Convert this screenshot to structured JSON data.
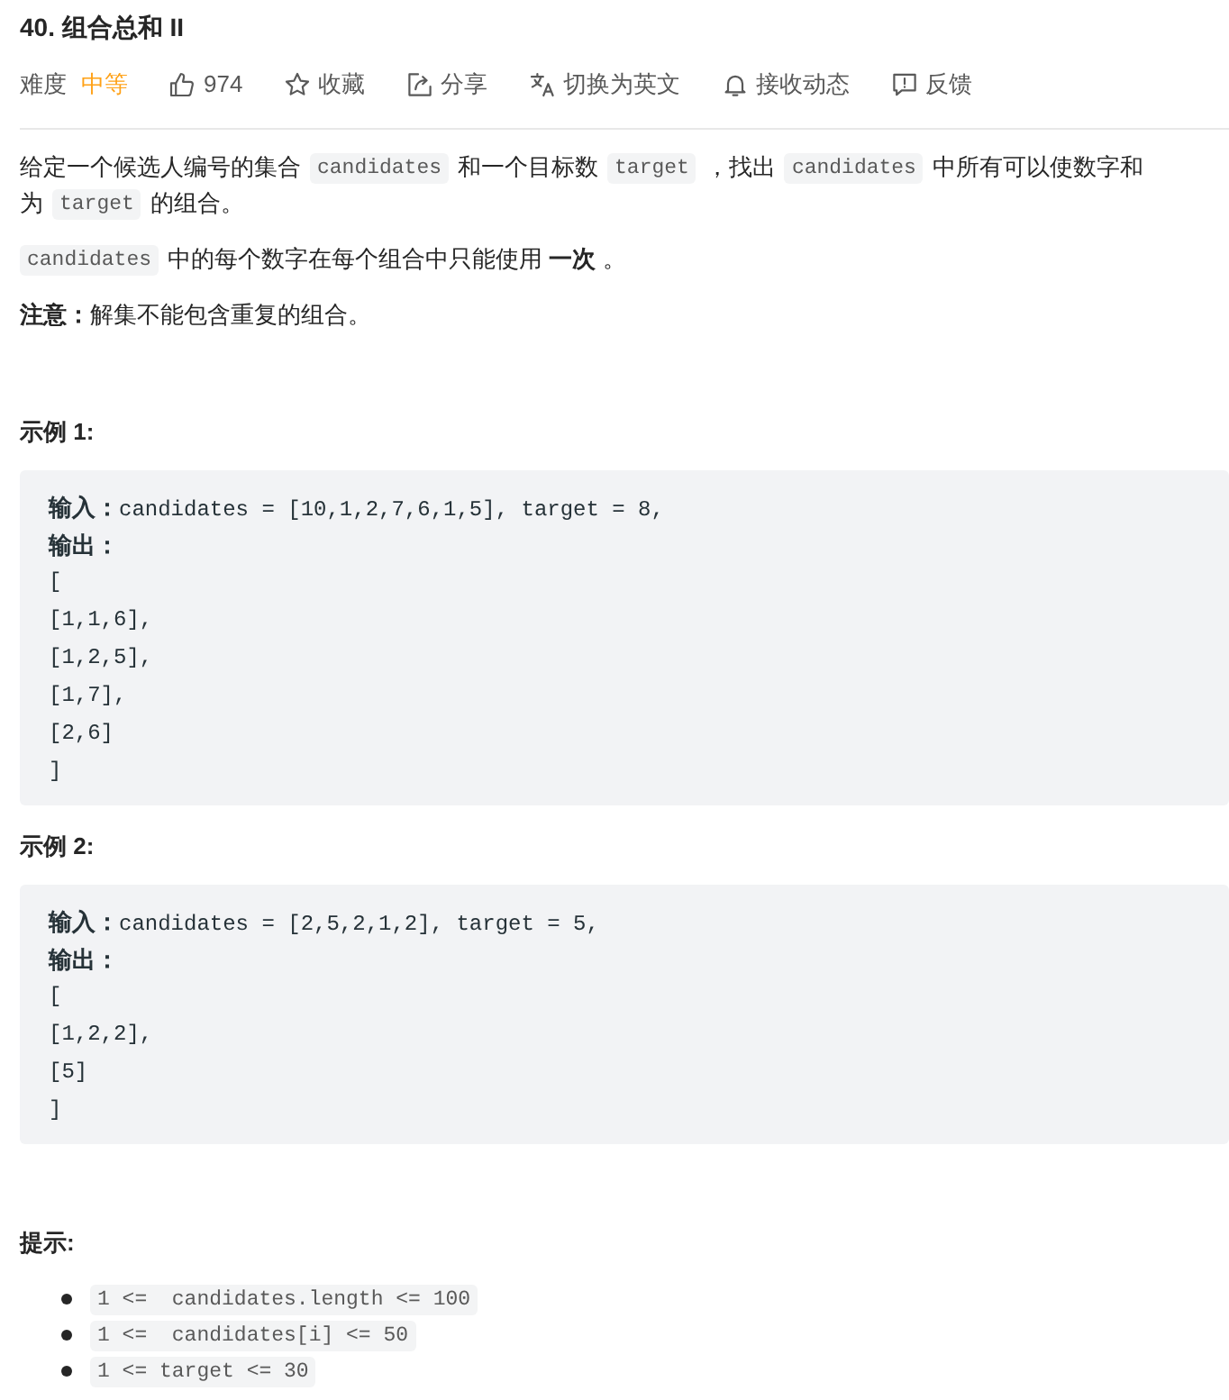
{
  "problem": {
    "title": "40. 组合总和 II"
  },
  "meta": {
    "difficulty": {
      "label": "难度",
      "value": "中等",
      "kind": "medium"
    },
    "actions": [
      {
        "kind": "like",
        "label": "974"
      },
      {
        "kind": "favorite",
        "label": "收藏"
      },
      {
        "kind": "share",
        "label": "分享"
      },
      {
        "kind": "translate",
        "label": "切换为英文"
      },
      {
        "kind": "subscribe",
        "label": "接收动态"
      },
      {
        "kind": "feedback",
        "label": "反馈"
      }
    ]
  },
  "description": [
    {
      "lines": [
        [
          {
            "kind": "text",
            "text": "给定一个候选人编号的集合"
          },
          {
            "kind": "code",
            "text": "candidates"
          },
          {
            "kind": "text",
            "text": "和一个目标数"
          },
          {
            "kind": "code",
            "text": "target"
          },
          {
            "kind": "text",
            "text": "，找出"
          },
          {
            "kind": "code",
            "text": "candidates"
          },
          {
            "kind": "text",
            "text": "中所有可以使数字和"
          }
        ],
        [
          {
            "kind": "text",
            "text": "为"
          },
          {
            "kind": "code",
            "text": "target"
          },
          {
            "kind": "text",
            "text": "的组合。"
          }
        ]
      ]
    },
    {
      "lines": [
        [
          {
            "kind": "code",
            "text": "candidates"
          },
          {
            "kind": "text",
            "text": "中的每个数字在每个组合中只能使用 **一次** 。"
          }
        ]
      ]
    },
    {
      "lines": [
        [
          {
            "kind": "text",
            "text": "**注意：**解集不能包含重复的组合。"
          }
        ]
      ]
    }
  ],
  "examples": [
    {
      "title": "示例 1:",
      "lines": [
        "**输入：**candidates = [10,1,2,7,6,1,5], target = 8,",
        "**输出：**",
        "[",
        "[1,1,6],",
        "[1,2,5],",
        "[1,7],",
        "[2,6]",
        "]"
      ]
    },
    {
      "title": "示例 2:",
      "lines": [
        "**输入：**candidates = [2,5,2,1,2], target = 5,",
        "**输出：**",
        "[",
        "[1,2,2],",
        "[5]",
        "]"
      ]
    }
  ],
  "hints": {
    "title": "提示:",
    "items": [
      "1 <=  candidates.length <= 100",
      "1 <=  candidates[i] <= 50",
      "1 <= target <= 30"
    ]
  }
}
